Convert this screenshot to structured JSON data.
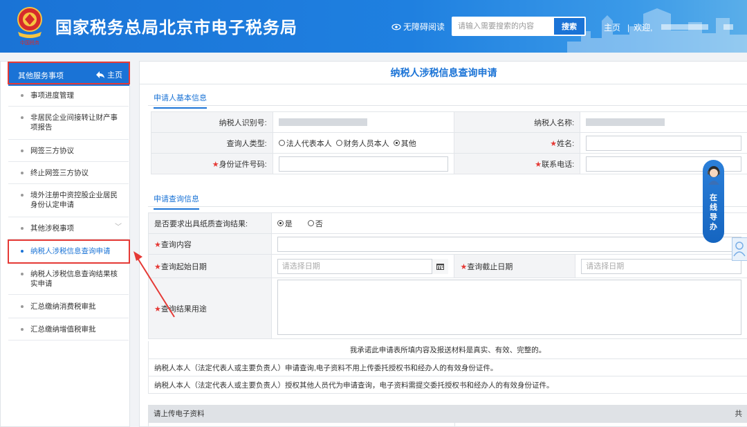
{
  "header": {
    "title": "国家税务总局北京市电子税务局",
    "accessibility_label": "无障碍阅读",
    "search_placeholder": "请输入需要搜索的内容",
    "search_button": "搜索",
    "home_link": "主页",
    "welcome_text": "欢迎,",
    "separator": "|",
    "emblem_caption": "中国税务"
  },
  "sidebar": {
    "header_title": "其他服务事项",
    "header_home": "主页",
    "items": [
      {
        "label": "事项进度管理"
      },
      {
        "label": "非居民企业间接转让财产事项报告"
      },
      {
        "label": "网签三方协议"
      },
      {
        "label": "终止网签三方协议"
      },
      {
        "label": "境外注册中资控股企业居民身份认定申请"
      },
      {
        "label": "其他涉税事项"
      },
      {
        "label": "纳税人涉税信息查询申请"
      },
      {
        "label": "纳税人涉税信息查询结果核实申请"
      },
      {
        "label": "汇总缴纳消费税审批"
      },
      {
        "label": "汇总缴纳增值税审批"
      }
    ],
    "active_index": 6
  },
  "main": {
    "page_title": "纳税人涉税信息查询申请",
    "section1_tab": "申请人基本信息",
    "section2_tab": "申请查询信息",
    "basic": {
      "taxpayer_id_label": "纳税人识别号:",
      "taxpayer_name_label": "纳税人名称:",
      "query_type_label": "查询人类型:",
      "query_type_options": [
        "法人代表本人",
        "财务人员本人",
        "其他"
      ],
      "query_type_selected": "其他",
      "name_label": "姓名:",
      "id_number_label": "身份证件号码:",
      "phone_label": "联系电话:",
      "required_mark": "★"
    },
    "query": {
      "paper_result_label": "是否要求出具纸质查询结果:",
      "paper_options": [
        "是",
        "否"
      ],
      "paper_selected": "是",
      "content_label": "查询内容",
      "start_date_label": "查询起始日期",
      "end_date_label": "查询截止日期",
      "date_placeholder": "请选择日期",
      "purpose_label": "查询结果用途"
    },
    "notes": [
      "我承诺此申请表所填内容及报送材料是真实、有效、完整的。",
      "纳税人本人（法定代表人或主要负责人）申请查询,电子资料不用上传委托授权书和经办人的有效身份证件。",
      "纳税人本人（法定代表人或主要负责人）授权其他人员代为申请查询，电子资料需提交委托授权书和经办人的有效身份证件。"
    ],
    "upload_label": "请上传电子资料",
    "upload_right": "共"
  },
  "widgets": {
    "online_guide_label": "在线导办",
    "online_guide_chars": [
      "在",
      "线",
      "导",
      "办"
    ]
  },
  "colors": {
    "brand_blue": "#1a73d6",
    "highlight_red": "#e53935"
  }
}
